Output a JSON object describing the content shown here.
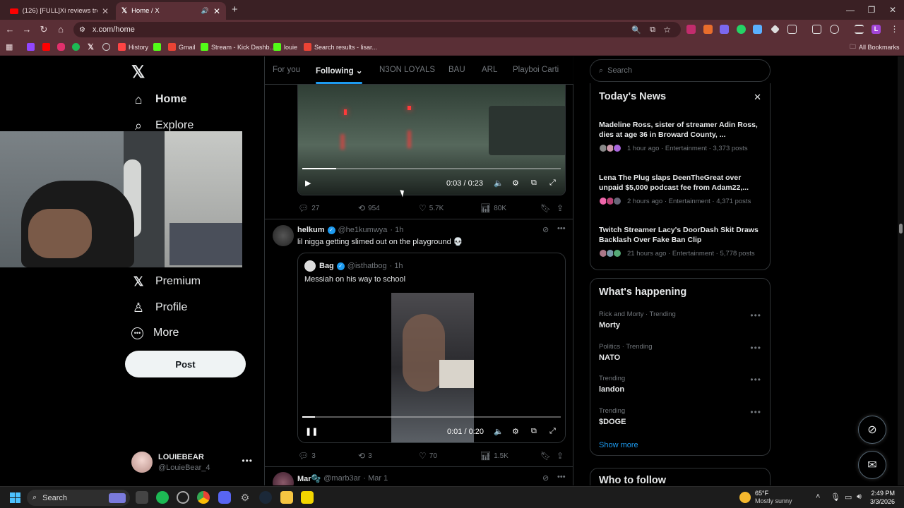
{
  "browser": {
    "tabs": [
      {
        "title": "(126) [FULL]Xi reviews troops to",
        "favicon_color": "#ff0000"
      },
      {
        "title": "Home / X",
        "favicon_color": "#ffffff"
      }
    ],
    "new_tab_icon": "plus-icon",
    "url": "x.com/home",
    "bookmarks": [
      {
        "label": "",
        "color": "#9146ff"
      },
      {
        "label": "",
        "color": "#ff0000"
      },
      {
        "label": "",
        "color": "#e1306c"
      },
      {
        "label": "",
        "color": "#1db954"
      },
      {
        "label": "",
        "color": "#ffffff"
      },
      {
        "label": "",
        "color": "#888888"
      },
      {
        "label": "History",
        "color": "#ff4444"
      },
      {
        "label": "",
        "color": "#53fc18"
      },
      {
        "label": "Gmail",
        "color": "#ea4335"
      },
      {
        "label": "Stream - Kick Dashb...",
        "color": "#53fc18"
      },
      {
        "label": "louie",
        "color": "#53fc18"
      },
      {
        "label": "Search results - lisar...",
        "color": "#ea4335"
      }
    ],
    "all_bookmarks": "All Bookmarks"
  },
  "sidebar": {
    "home": "Home",
    "explore": "Explore",
    "premium": "Premium",
    "profile": "Profile",
    "more": "More",
    "post": "Post",
    "account_name": "LOUIEBEAR",
    "account_handle": "@LouieBear_4"
  },
  "feed": {
    "tabs": [
      "For you",
      "Following",
      "N3ON LOYALS",
      "BAU",
      "ARL",
      "Playboi Carti"
    ],
    "video1": {
      "time": "0:03 / 0:23",
      "progress": 0.13,
      "stats": {
        "replies": "27",
        "reposts": "954",
        "likes": "5.7K",
        "views": "80K"
      }
    },
    "post2": {
      "name": "helkum",
      "handle": "@he1kumwya",
      "time": "· 1h",
      "text": "lil nigga getting slimed out on the playground 💀",
      "quote": {
        "name": "Bag",
        "handle": "@isthatbog",
        "time": "· 1h",
        "text": "Messiah on his way to school",
        "video_time": "0:01 / 0:20",
        "progress": 0.05
      },
      "stats": {
        "replies": "3",
        "reposts": "3",
        "likes": "70",
        "views": "1.5K"
      }
    },
    "post3": {
      "name": "Mar🫧",
      "handle": "@marb3ar",
      "time": "· Mar 1"
    }
  },
  "right": {
    "search_placeholder": "Search",
    "todays_news": "Today's News",
    "news": [
      {
        "title": "Madeline Ross, sister of streamer Adin Ross, dies at age 36 in Broward County, ...",
        "meta": "1 hour ago · Entertainment · 3,373 posts"
      },
      {
        "title": "Lena The Plug slaps DeenTheGreat over unpaid $5,000 podcast fee from Adam22,...",
        "meta": "2 hours ago · Entertainment · 4,371 posts"
      },
      {
        "title": "Twitch Streamer Lacy's DoorDash Skit Draws Backlash Over Fake Ban Clip",
        "meta": "21 hours ago · Entertainment · 5,778 posts"
      }
    ],
    "whats_happening": "What's happening",
    "trends": [
      {
        "category": "Rick and Morty · Trending",
        "name": "Morty"
      },
      {
        "category": "Politics · Trending",
        "name": "NATO"
      },
      {
        "category": "Trending",
        "name": "landon"
      },
      {
        "category": "Trending",
        "name": "$DOGE"
      }
    ],
    "show_more": "Show more",
    "who_to_follow": "Who to follow"
  },
  "taskbar": {
    "search": "Search",
    "weather_temp": "65°F",
    "weather_desc": "Mostly sunny",
    "time": "2:49 PM",
    "date": "3/3/2026"
  },
  "colors": {
    "accent": "#1d9bf0",
    "chrome_dark": "#3a2024",
    "chrome": "#5a2f36"
  }
}
